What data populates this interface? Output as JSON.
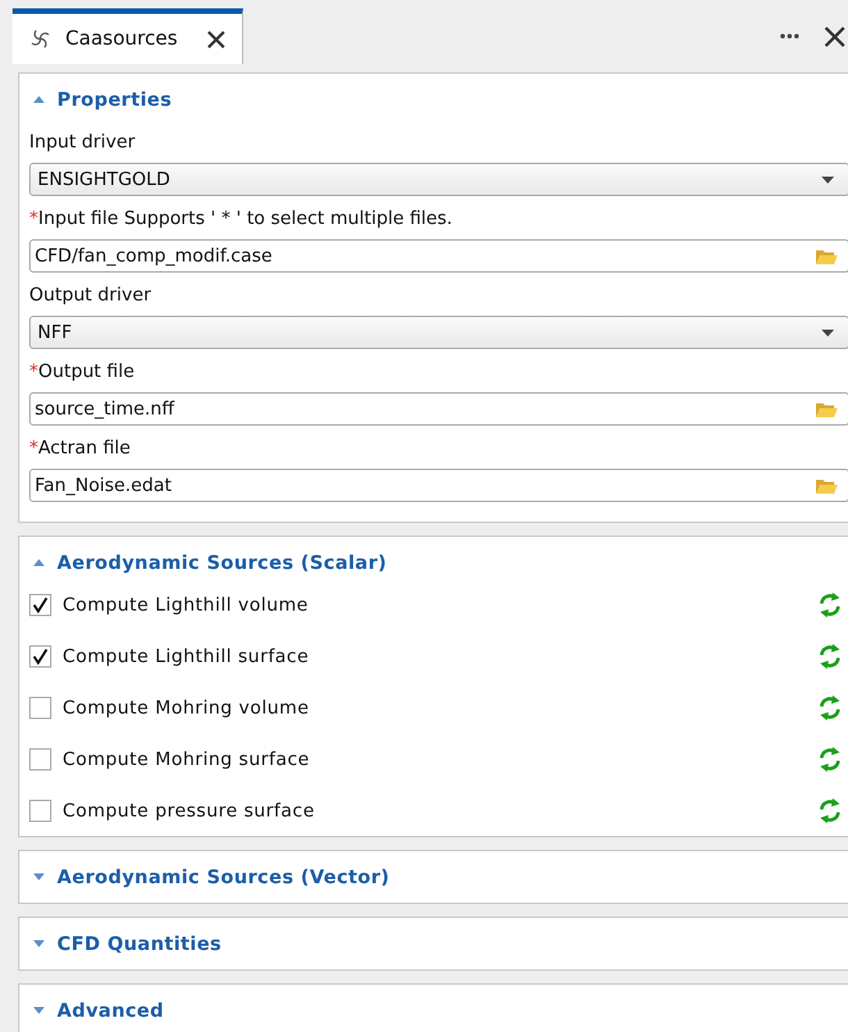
{
  "tab": {
    "title": "Caasources",
    "selected": true
  },
  "sections": [
    {
      "title": "Properties",
      "expanded": true,
      "kind": "form",
      "fields": [
        {
          "label": "Input driver",
          "kind": "select",
          "value": "ENSIGHTGOLD"
        },
        {
          "label": "Input file Supports ' * ' to select multiple files.",
          "mark": "*",
          "kind": "file",
          "value": "CFD/fan_comp_modif.case"
        },
        {
          "label": "Output driver",
          "kind": "select",
          "value": "NFF"
        },
        {
          "label": "Output file",
          "mark": "*",
          "kind": "file",
          "value": "source_time.nff"
        },
        {
          "label": "Actran file",
          "mark": "*",
          "kind": "file",
          "value": "Fan_Noise.edat"
        }
      ]
    },
    {
      "title": "Aerodynamic Sources (Scalar)",
      "expanded": true,
      "kind": "checklist",
      "items": [
        {
          "label": "Compute Lighthill volume",
          "checked": true
        },
        {
          "label": "Compute Lighthill surface",
          "checked": true
        },
        {
          "label": "Compute Mohring volume",
          "checked": false
        },
        {
          "label": "Compute Mohring surface",
          "checked": false
        },
        {
          "label": "Compute pressure surface",
          "checked": false
        }
      ]
    },
    {
      "title": "Aerodynamic Sources (Vector)",
      "expanded": false
    },
    {
      "title": "CFD Quantities",
      "expanded": false
    },
    {
      "title": "Advanced",
      "expanded": false
    }
  ]
}
